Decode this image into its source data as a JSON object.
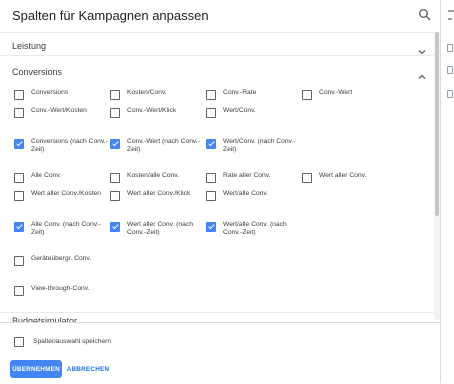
{
  "dialog": {
    "title": "Spalten für Kampagnen anpassen"
  },
  "sections": {
    "leistung": "Leistung",
    "conversions": "Conversions",
    "budgetsimulator": "Budgetsimulator"
  },
  "options": [
    {
      "label": "Conversions",
      "checked": false
    },
    {
      "label": "Kosten/Conv.",
      "checked": false
    },
    {
      "label": "Conv.-Rate",
      "checked": false
    },
    {
      "label": "Conv.-Wert",
      "checked": false
    },
    {
      "label": "Conv.-Wert/Kosten",
      "checked": false
    },
    {
      "label": "Conv.-Wert/Klick",
      "checked": false
    },
    {
      "label": "Wert/Conv.",
      "checked": false
    },
    {
      "label": "Conversions (nach Conv.-Zeit)",
      "checked": true
    },
    {
      "label": "Conv.-Wert (nach Conv.-Zeit)",
      "checked": true
    },
    {
      "label": "Wert/Conv. (nach Conv.-Zeit)",
      "checked": true
    },
    {
      "label": "Alle Conv.",
      "checked": false
    },
    {
      "label": "Kosten/alle Conv.",
      "checked": false
    },
    {
      "label": "Rate aller Conv.",
      "checked": false
    },
    {
      "label": "Wert aller Conv.",
      "checked": false
    },
    {
      "label": "Wert aller Conv./Kosten",
      "checked": false
    },
    {
      "label": "Wert aller Conv./Klick",
      "checked": false
    },
    {
      "label": "Wert/alle Conv.",
      "checked": false
    },
    {
      "label": "Alle Conv. (nach Conv.-Zeit)",
      "checked": true
    },
    {
      "label": "Wert aller Conv. (nach Conv.-Zeit)",
      "checked": true
    },
    {
      "label": "Wert/alle Conv. (nach Conv.-Zeit)",
      "checked": true
    },
    {
      "label": "Geräteübergr. Conv.",
      "checked": false
    },
    {
      "label": "View-through-Conv.",
      "checked": false
    }
  ],
  "footer": {
    "save_label": "Spaltenauswahl speichern",
    "save_checked": false,
    "apply_label": "ÜBERNEHMEN",
    "cancel_label": "ABBRECHEN"
  },
  "icons": {
    "search": "search-icon",
    "expand": "chevron-down-icon",
    "collapse": "chevron-up-icon"
  },
  "colors": {
    "accent": "#4285f4",
    "link": "#1a73e8"
  }
}
